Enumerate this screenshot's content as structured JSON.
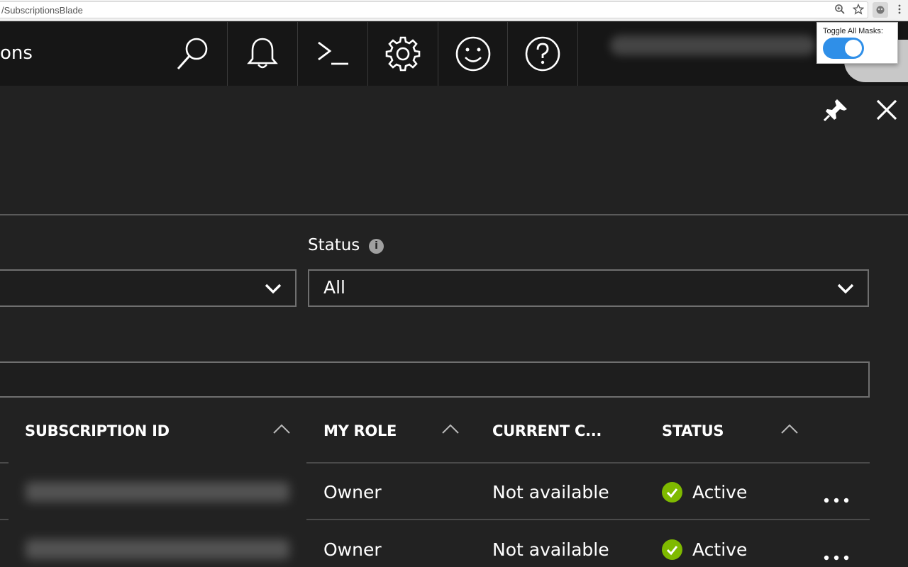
{
  "browser": {
    "url": "/SubscriptionsBlade"
  },
  "topbar": {
    "title_fragment": "ons",
    "nav_buttons": [
      "search",
      "notifications",
      "cloud-shell",
      "settings",
      "feedback",
      "help"
    ]
  },
  "popup": {
    "label": "Toggle All Masks:",
    "toggle_on": true
  },
  "filters": {
    "status_label": "Status",
    "status_value": "All",
    "left_value": ""
  },
  "table": {
    "headers": [
      "SUBSCRIPTION ID",
      "MY ROLE",
      "CURRENT C...",
      "STATUS"
    ],
    "rows": [
      {
        "role": "Owner",
        "cost": "Not available",
        "status": "Active"
      },
      {
        "role": "Owner",
        "cost": "Not available",
        "status": "Active"
      }
    ]
  },
  "colors": {
    "accent_toggle": "#2f8fe8",
    "status_ok": "#7fba00",
    "background": "#222222"
  }
}
